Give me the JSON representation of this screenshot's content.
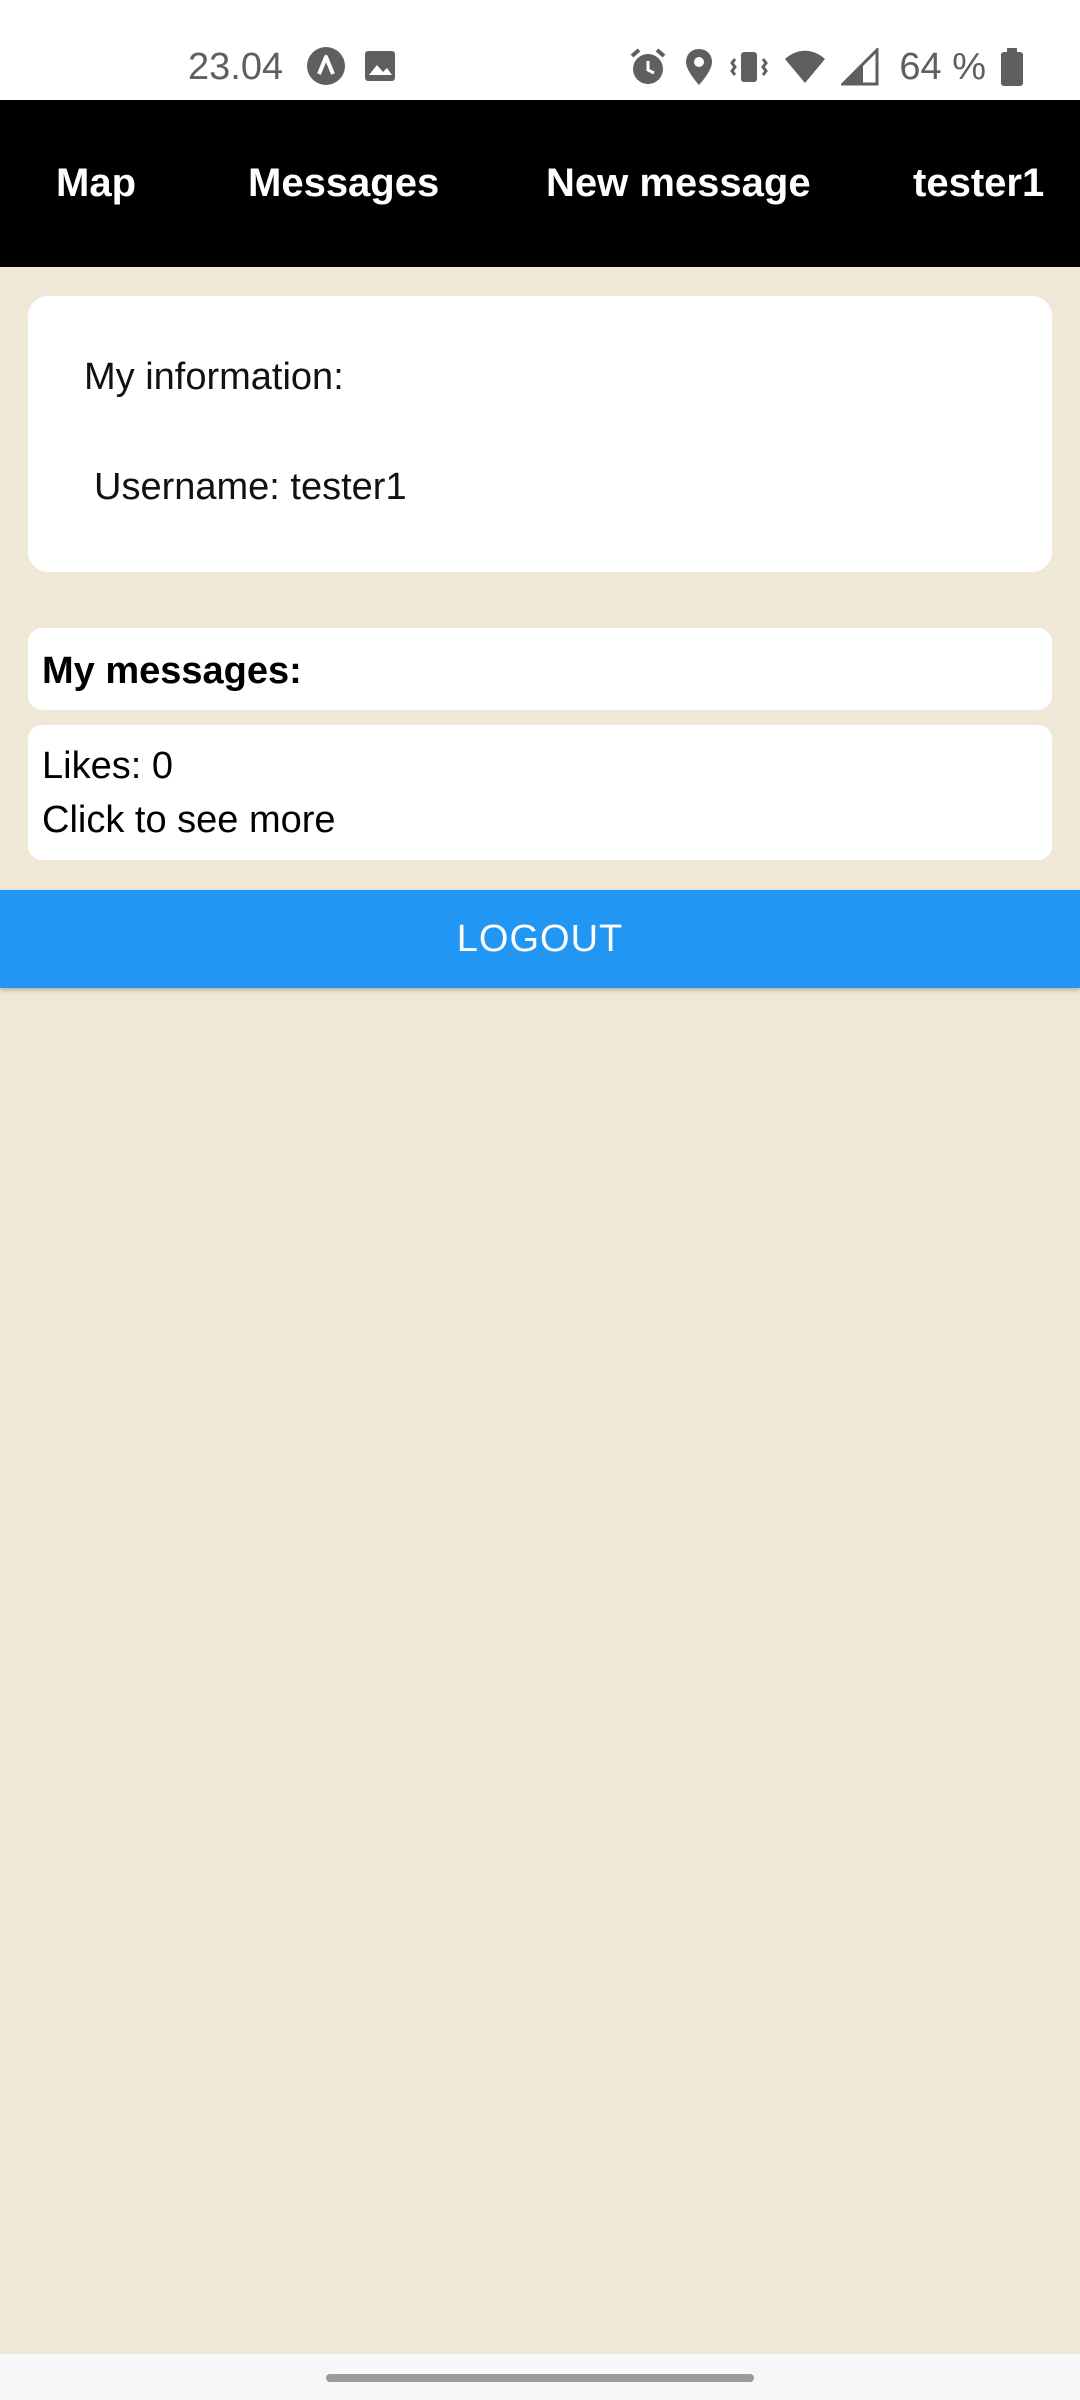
{
  "status_bar": {
    "time": "23.04",
    "battery_percent": "64 %",
    "left_icons": [
      "app-a-icon",
      "image-icon"
    ],
    "right_icons": [
      "alarm-icon",
      "location-icon",
      "vibrate-icon",
      "wifi-icon",
      "signal-icon",
      "battery-icon"
    ]
  },
  "nav": {
    "map": "Map",
    "messages": "Messages",
    "new_message": "New message",
    "user": "tester1"
  },
  "info": {
    "title": "My information:",
    "username": "Username: tester1"
  },
  "messages": {
    "header": "My messages:",
    "items": [
      {
        "likes": "Likes: 0",
        "more": "Click to see more"
      }
    ]
  },
  "logout_label": "LOGOUT",
  "colors": {
    "background": "#efe8d7",
    "nav_bg": "#000000",
    "button_blue": "#2196f3"
  }
}
